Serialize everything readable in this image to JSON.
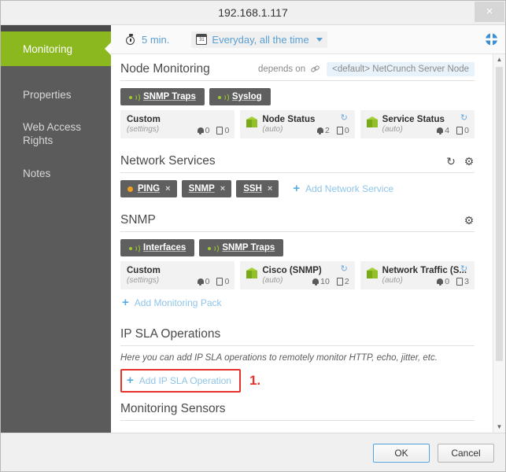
{
  "window": {
    "title": "192.168.1.117",
    "close_label": "×"
  },
  "sidebar": {
    "items": [
      {
        "label": "Monitoring",
        "active": true
      },
      {
        "label": "Properties",
        "active": false
      },
      {
        "label": "Web Access Rights",
        "active": false
      },
      {
        "label": "Notes",
        "active": false
      }
    ]
  },
  "toolbar": {
    "interval": "5 min.",
    "interval_icon": "stopwatch-icon",
    "schedule": "Everyday, all the time",
    "schedule_icon": "calendar-icon",
    "calendar_day": "31",
    "globe_icon": "globe-icon"
  },
  "sections": {
    "node_monitoring": {
      "title": "Node Monitoring",
      "depends_label": "depends on",
      "depends_icon": "link-icon",
      "depends_value": "<default> NetCrunch Server Node",
      "pills": [
        {
          "label": "SNMP Traps",
          "icon": "signal-wave-icon"
        },
        {
          "label": "Syslog",
          "icon": "signal-wave-icon"
        }
      ],
      "cards": [
        {
          "title": "Custom",
          "subtitle": "(settings)",
          "alerts": "0",
          "reports": "0",
          "has_cube": false,
          "has_refresh": false
        },
        {
          "title": "Node Status",
          "subtitle": "(auto)",
          "alerts": "2",
          "reports": "0",
          "has_cube": true,
          "has_refresh": true
        },
        {
          "title": "Service Status",
          "subtitle": "(auto)",
          "alerts": "4",
          "reports": "0",
          "has_cube": true,
          "has_refresh": true
        }
      ]
    },
    "network_services": {
      "title": "Network Services",
      "refresh_icon": "refresh-icon",
      "gear_icon": "gear-icon",
      "tags": [
        {
          "label": "PING",
          "dot": true,
          "close": "×"
        },
        {
          "label": "SNMP",
          "dot": false,
          "close": "×"
        },
        {
          "label": "SSH",
          "dot": false,
          "close": "×"
        }
      ],
      "add_label": "Add Network Service"
    },
    "snmp": {
      "title": "SNMP",
      "gear_icon": "gear-icon",
      "pills": [
        {
          "label": "Interfaces",
          "icon": "signal-wave-icon"
        },
        {
          "label": "SNMP Traps",
          "icon": "signal-wave-icon"
        }
      ],
      "cards": [
        {
          "title": "Custom",
          "subtitle": "(settings)",
          "alerts": "0",
          "reports": "0",
          "has_cube": false,
          "has_refresh": false
        },
        {
          "title": "Cisco (SNMP)",
          "subtitle": "(auto)",
          "alerts": "10",
          "reports": "2",
          "has_cube": true,
          "has_refresh": true
        },
        {
          "title": "Network Traffic (S...",
          "subtitle": "(auto)",
          "alerts": "0",
          "reports": "3",
          "has_cube": true,
          "has_refresh": true
        }
      ],
      "add_label": "Add Monitoring Pack"
    },
    "ip_sla": {
      "title": "IP SLA Operations",
      "hint": "Here you can add IP SLA operations to remotely monitor HTTP, echo, jitter, etc.",
      "add_label": "Add IP SLA Operation",
      "step_number": "1.",
      "highlight_color": "#e8312a"
    },
    "monitoring_sensors": {
      "title": "Monitoring Sensors"
    }
  },
  "scrollbar": {
    "up_arrow": "▲",
    "down_arrow": "▼"
  },
  "footer": {
    "ok_label": "OK",
    "cancel_label": "Cancel"
  },
  "colors": {
    "accent_green": "#8cb81f",
    "link_blue": "#8fc4e8",
    "annotation_red": "#e8312a",
    "sidebar_bg": "#5b5b5b"
  }
}
